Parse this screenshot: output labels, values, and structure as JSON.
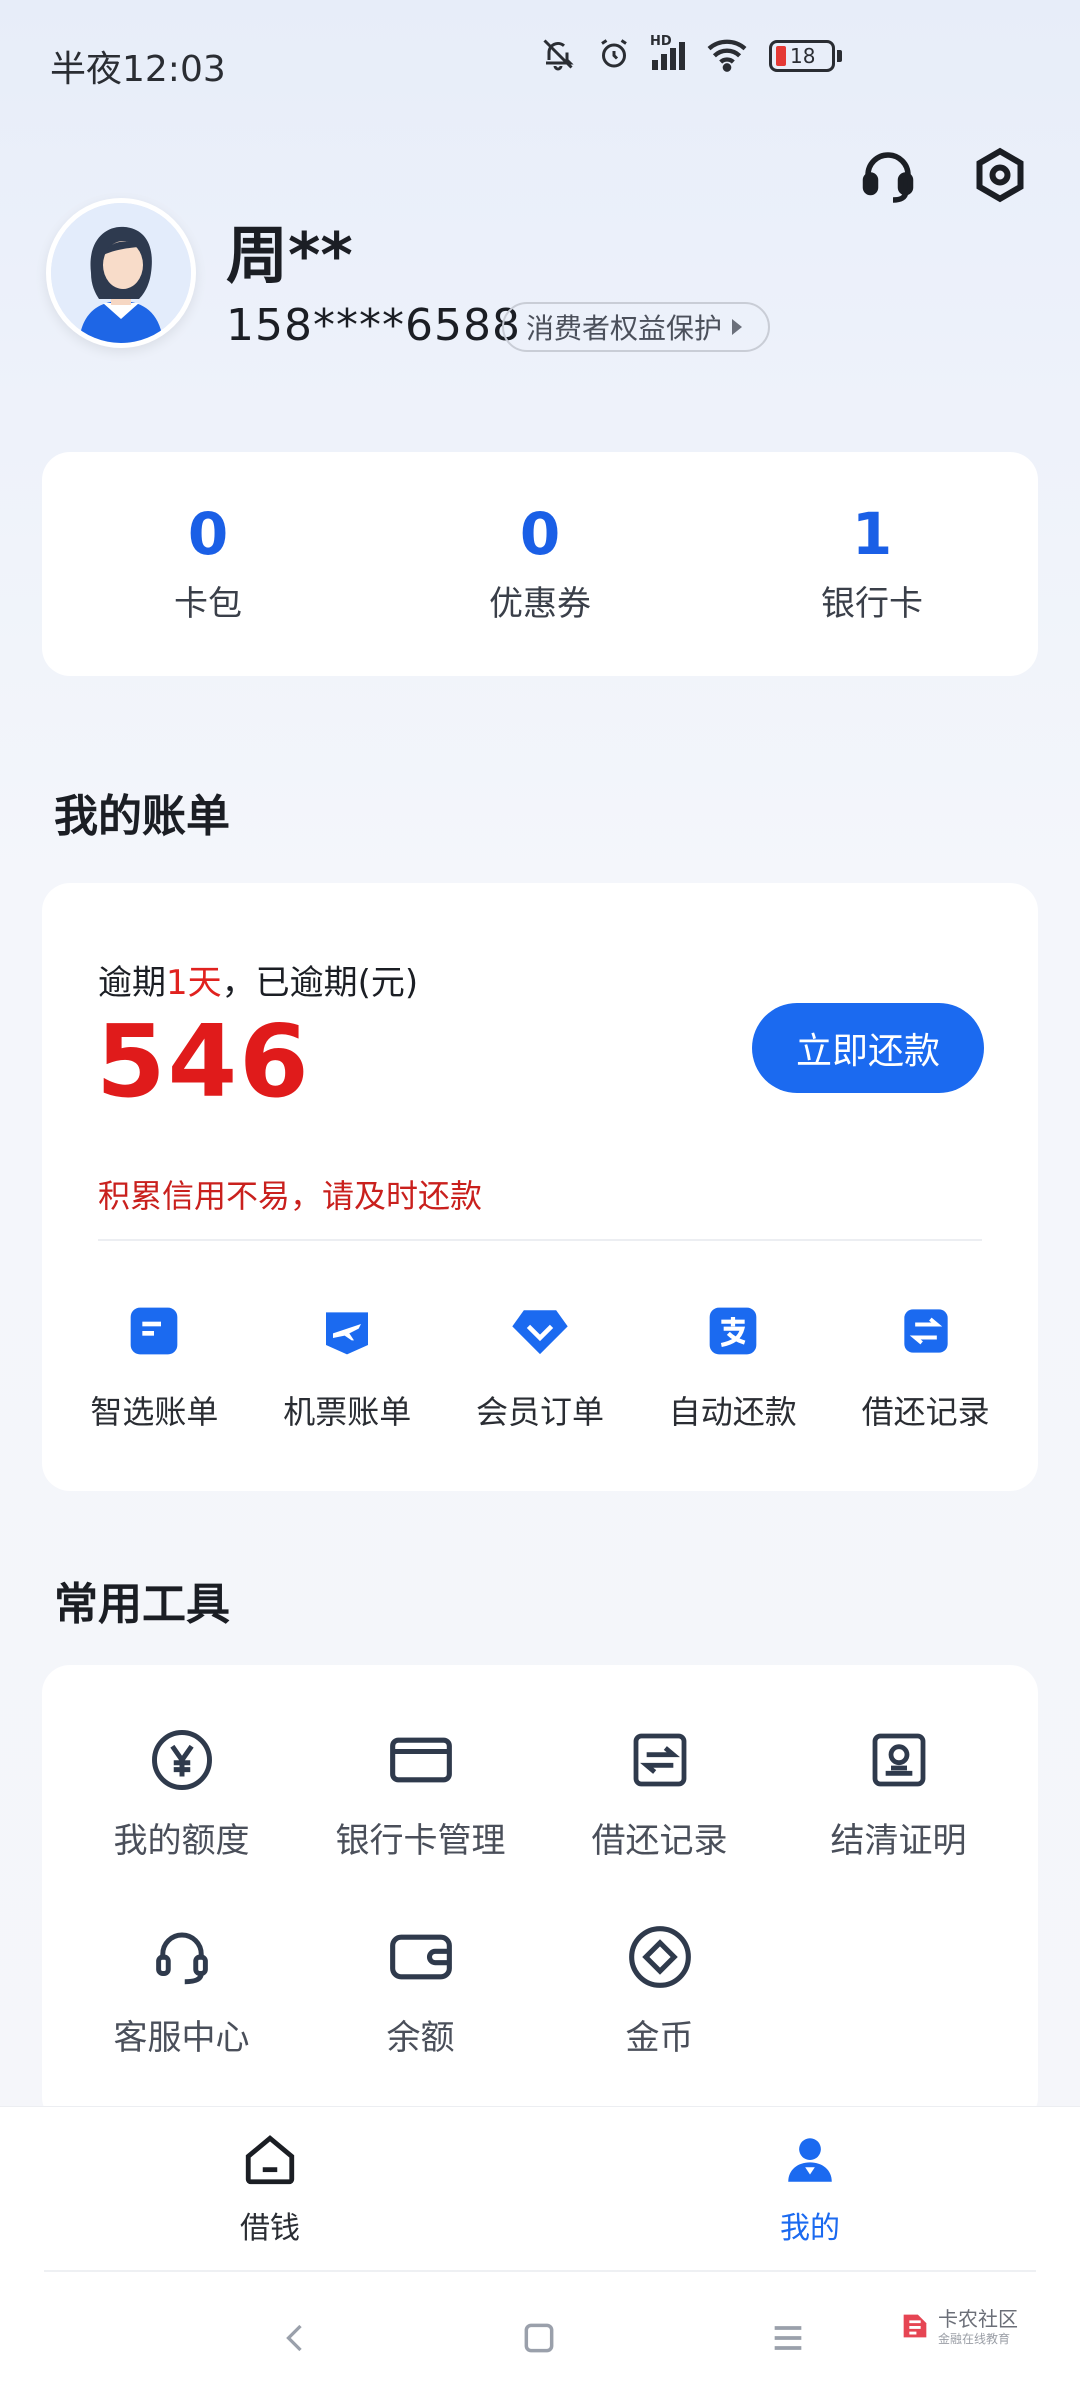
{
  "status_bar": {
    "time": "半夜12:03",
    "network": "HD",
    "battery": "18"
  },
  "top_icons": [
    "headset-icon",
    "settings-icon"
  ],
  "profile": {
    "name": "周**",
    "phone": "158****6588",
    "rights_label": "消费者权益保护"
  },
  "stats": [
    {
      "value": "0",
      "label": "卡包"
    },
    {
      "value": "0",
      "label": "优惠券"
    },
    {
      "value": "1",
      "label": "银行卡"
    }
  ],
  "bill_section": {
    "title": "我的账单",
    "overdue_prefix": "逾期",
    "overdue_days": "1天",
    "overdue_suffix": "，已逾期(元)",
    "amount": "546",
    "repay_button": "立即还款",
    "tip": "积累信用不易，请及时还款",
    "shortcuts": [
      {
        "label": "智选账单",
        "icon": "bill-icon"
      },
      {
        "label": "机票账单",
        "icon": "plane-icon"
      },
      {
        "label": "会员订单",
        "icon": "diamond-icon"
      },
      {
        "label": "自动还款",
        "icon": "alipay-icon"
      },
      {
        "label": "借还记录",
        "icon": "swap-icon"
      }
    ]
  },
  "tools_section": {
    "title": "常用工具",
    "items": [
      {
        "label": "我的额度",
        "icon": "yen-circle-icon"
      },
      {
        "label": "银行卡管理",
        "icon": "card-icon"
      },
      {
        "label": "借还记录",
        "icon": "swap-icon"
      },
      {
        "label": "结清证明",
        "icon": "certificate-icon"
      },
      {
        "label": "客服中心",
        "icon": "headset-icon"
      },
      {
        "label": "余额",
        "icon": "wallet-icon"
      },
      {
        "label": "金币",
        "icon": "coin-icon"
      }
    ]
  },
  "bottom_nav": {
    "borrow": "借钱",
    "mine": "我的"
  },
  "watermark": {
    "main": "卡农社区",
    "sub": "金融在线教育"
  },
  "colors": {
    "accent": "#1b6af0",
    "danger": "#e01b1b"
  }
}
